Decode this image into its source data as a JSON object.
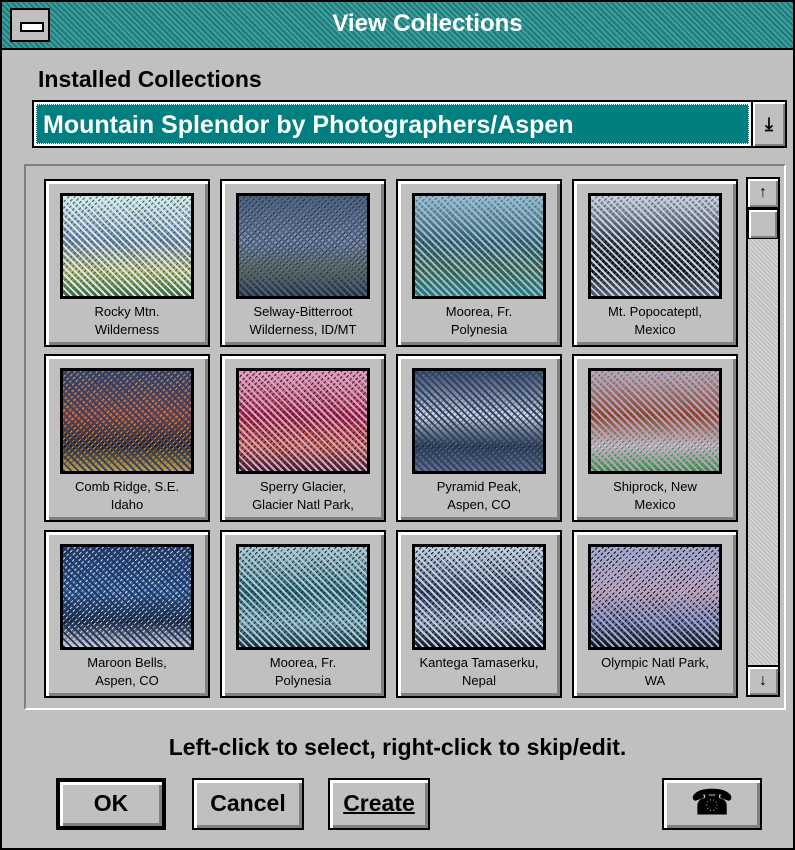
{
  "window": {
    "title": "View Collections"
  },
  "installed": {
    "label": "Installed Collections",
    "selected": "Mountain Splendor by Photographers/Aspen",
    "dropdown_icon": "arrow-down-icon"
  },
  "thumbnails": [
    {
      "line1": "Rocky Mtn.",
      "line2": "Wilderness",
      "colors": [
        "#d8e8f0",
        "#6a7ab0",
        "#3a6a3a",
        "#c0b060"
      ]
    },
    {
      "line1": "Selway-Bitterroot",
      "line2": "Wilderness, ID/MT",
      "colors": [
        "#506080",
        "#8090b0",
        "#203040",
        "#607050"
      ]
    },
    {
      "line1": "Moorea, Fr.",
      "line2": "Polynesia",
      "colors": [
        "#a0b8d0",
        "#305060",
        "#208080",
        "#405830"
      ]
    },
    {
      "line1": "Mt. Popocateptl,",
      "line2": "Mexico",
      "colors": [
        "#c8d0e0",
        "#202830",
        "#506070",
        "#101010"
      ]
    },
    {
      "line1": "Comb Ridge, S.E.",
      "line2": "Idaho",
      "colors": [
        "#304070",
        "#a04030",
        "#c0a040",
        "#301810"
      ]
    },
    {
      "line1": "Sperry Glacier,",
      "line2": "Glacier Natl Park,",
      "colors": [
        "#e0a0c0",
        "#a02040",
        "#302030",
        "#c06040"
      ]
    },
    {
      "line1": "Pyramid Peak,",
      "line2": "Aspen, CO",
      "colors": [
        "#304060",
        "#d0d8e0",
        "#607090",
        "#203040"
      ]
    },
    {
      "line1": "Shiprock, New",
      "line2": "Mexico",
      "colors": [
        "#c0a0c0",
        "#a03020",
        "#309040",
        "#d0c0d0"
      ]
    },
    {
      "line1": "Maroon Bells,",
      "line2": "Aspen, CO",
      "colors": [
        "#203868",
        "#3060a0",
        "#d0d0d0",
        "#102030"
      ]
    },
    {
      "line1": "Moorea, Fr.",
      "line2": "Polynesia",
      "colors": [
        "#b0c8d0",
        "#206070",
        "#103040",
        "#70a0b0"
      ]
    },
    {
      "line1": "Kantega Tamaserku,",
      "line2": "Nepal",
      "colors": [
        "#c0d0e0",
        "#304060",
        "#101820",
        "#8090b0"
      ]
    },
    {
      "line1": "Olympic Natl Park,",
      "line2": "WA",
      "colors": [
        "#a0a8d0",
        "#d0a0b0",
        "#101010",
        "#6070a0"
      ]
    }
  ],
  "scrollbar": {
    "up_icon": "arrow-up-icon",
    "down_icon": "arrow-down-icon"
  },
  "hint": "Left-click to select, right-click to skip/edit.",
  "buttons": {
    "ok": "OK",
    "cancel": "Cancel",
    "create": "Create",
    "phone_icon": "telephone-icon"
  }
}
